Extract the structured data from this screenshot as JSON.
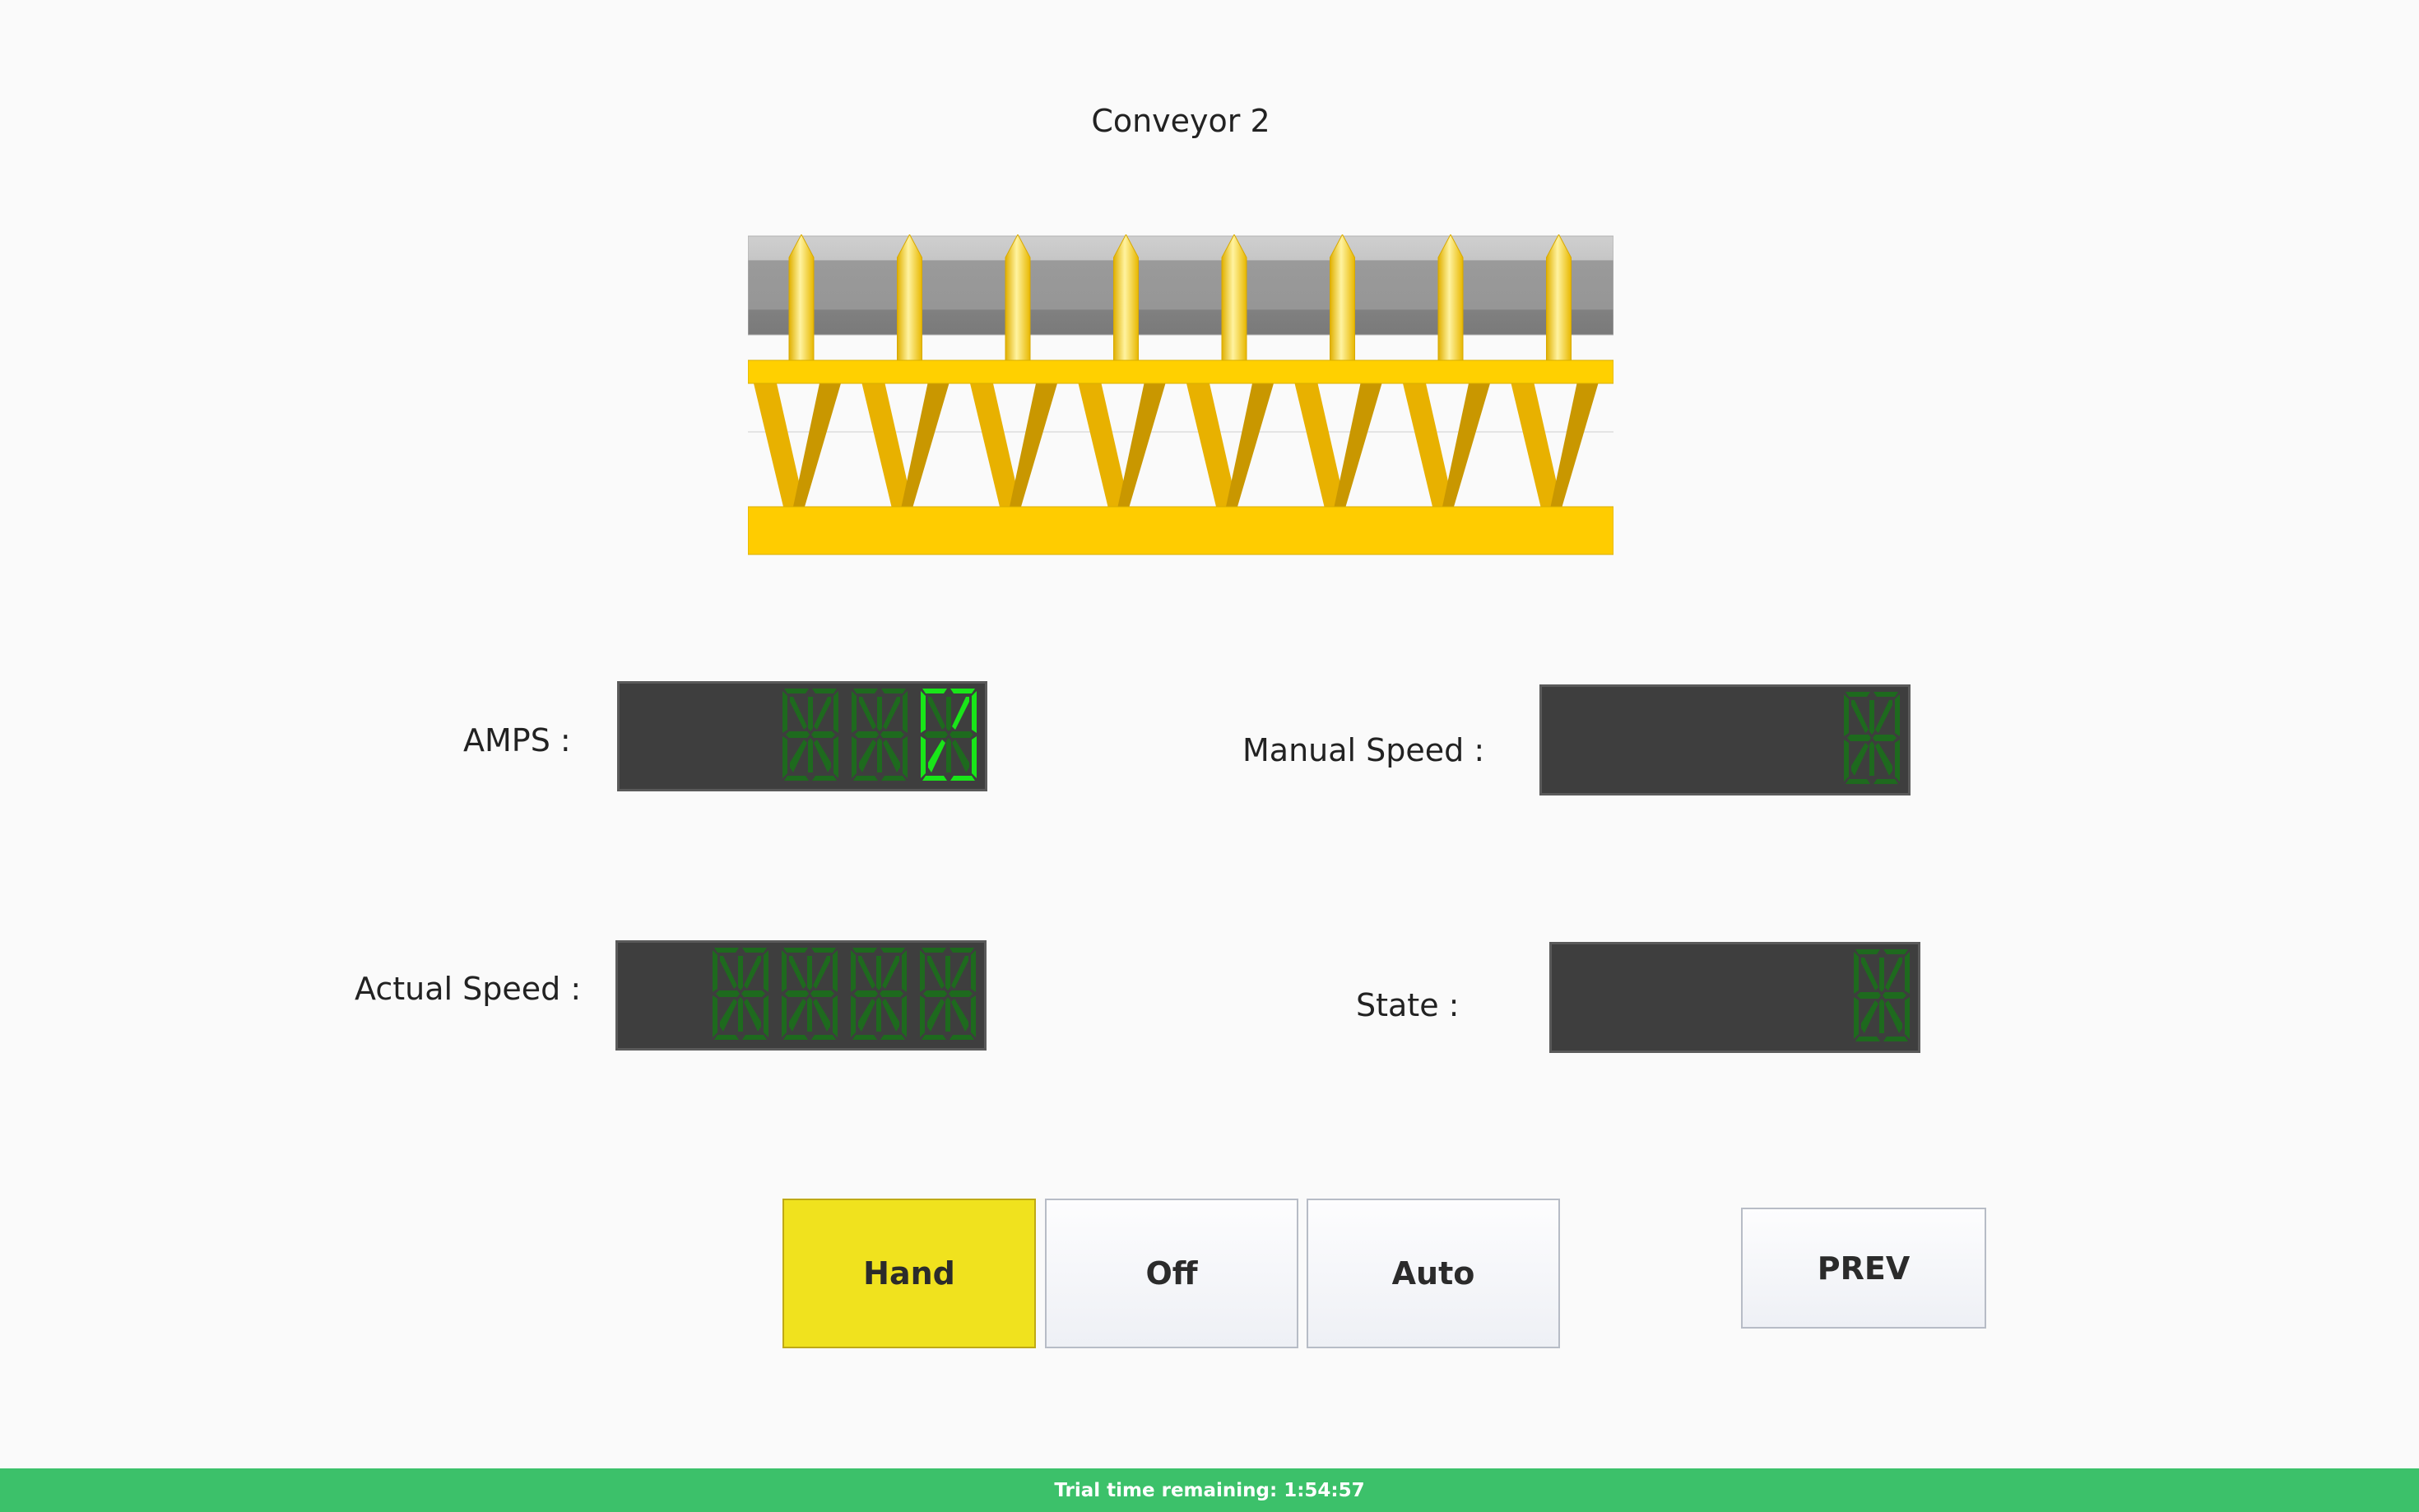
{
  "header": {
    "title": "Conveyor 2"
  },
  "readouts": {
    "amps": {
      "label": "AMPS :",
      "value": "0"
    },
    "manual_speed": {
      "label": "Manual Speed :",
      "value": ""
    },
    "actual_speed": {
      "label": "Actual Speed :",
      "value": ""
    },
    "state": {
      "label": "State :",
      "value": ""
    }
  },
  "controls": {
    "hand": "Hand",
    "off": "Off",
    "auto": "Auto",
    "prev": "PREV",
    "active_mode": "Hand"
  },
  "footer": {
    "trial": "Trial time remaining: 1:54:57"
  },
  "colors": {
    "segment_on": "#19e619",
    "segment_off": "#1e6a1e",
    "display_bg": "#3e3e3e",
    "conveyor_frame": "#ffd000",
    "conveyor_belt": "#9a9a9a",
    "active_button": "#f0e21e",
    "trial_bar": "#3cc16a"
  }
}
